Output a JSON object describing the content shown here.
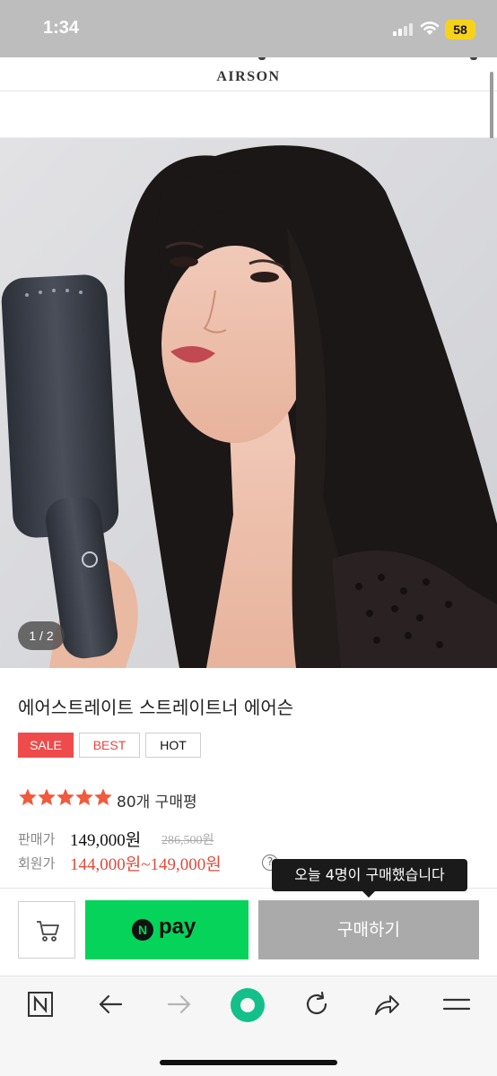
{
  "status_bar": {
    "time": "1:34",
    "battery": "58",
    "battery_color": "#f7d21a"
  },
  "header": {
    "brand": "AIRSON"
  },
  "gallery": {
    "counter": "1 / 2"
  },
  "product": {
    "name": "에어스트레이트 스트레이트너 에어슨",
    "badges": [
      {
        "label": "SALE",
        "color": "#ef4b4b"
      },
      {
        "label": "BEST",
        "color": "#e94444"
      },
      {
        "label": "HOT",
        "color": "#111111"
      }
    ],
    "rating": {
      "stars": 5,
      "max_stars": 5,
      "star_color": "#f15a3d",
      "review_count": "80개 구매평"
    },
    "price": {
      "sale_label": "판매가",
      "sale_price": "149,000원",
      "original_price": "286,500원",
      "member_label": "회원가",
      "member_price": "144,000원~149,000원",
      "member_price_color": "#e24a3b"
    },
    "help_icon": "question-icon",
    "tooltip": "오늘 4명이 구매했습니다"
  },
  "buy_bar": {
    "cart_icon": "cart-icon",
    "npay_logo": "N",
    "npay_label": "pay",
    "npay_color": "#06d35a",
    "buy_label": "구매하기"
  },
  "browser_toolbar": {
    "items": [
      "naver-home-icon",
      "back-arrow-icon",
      "forward-arrow-icon",
      "green-dot-icon",
      "reload-icon",
      "share-icon",
      "menu-icon"
    ]
  }
}
